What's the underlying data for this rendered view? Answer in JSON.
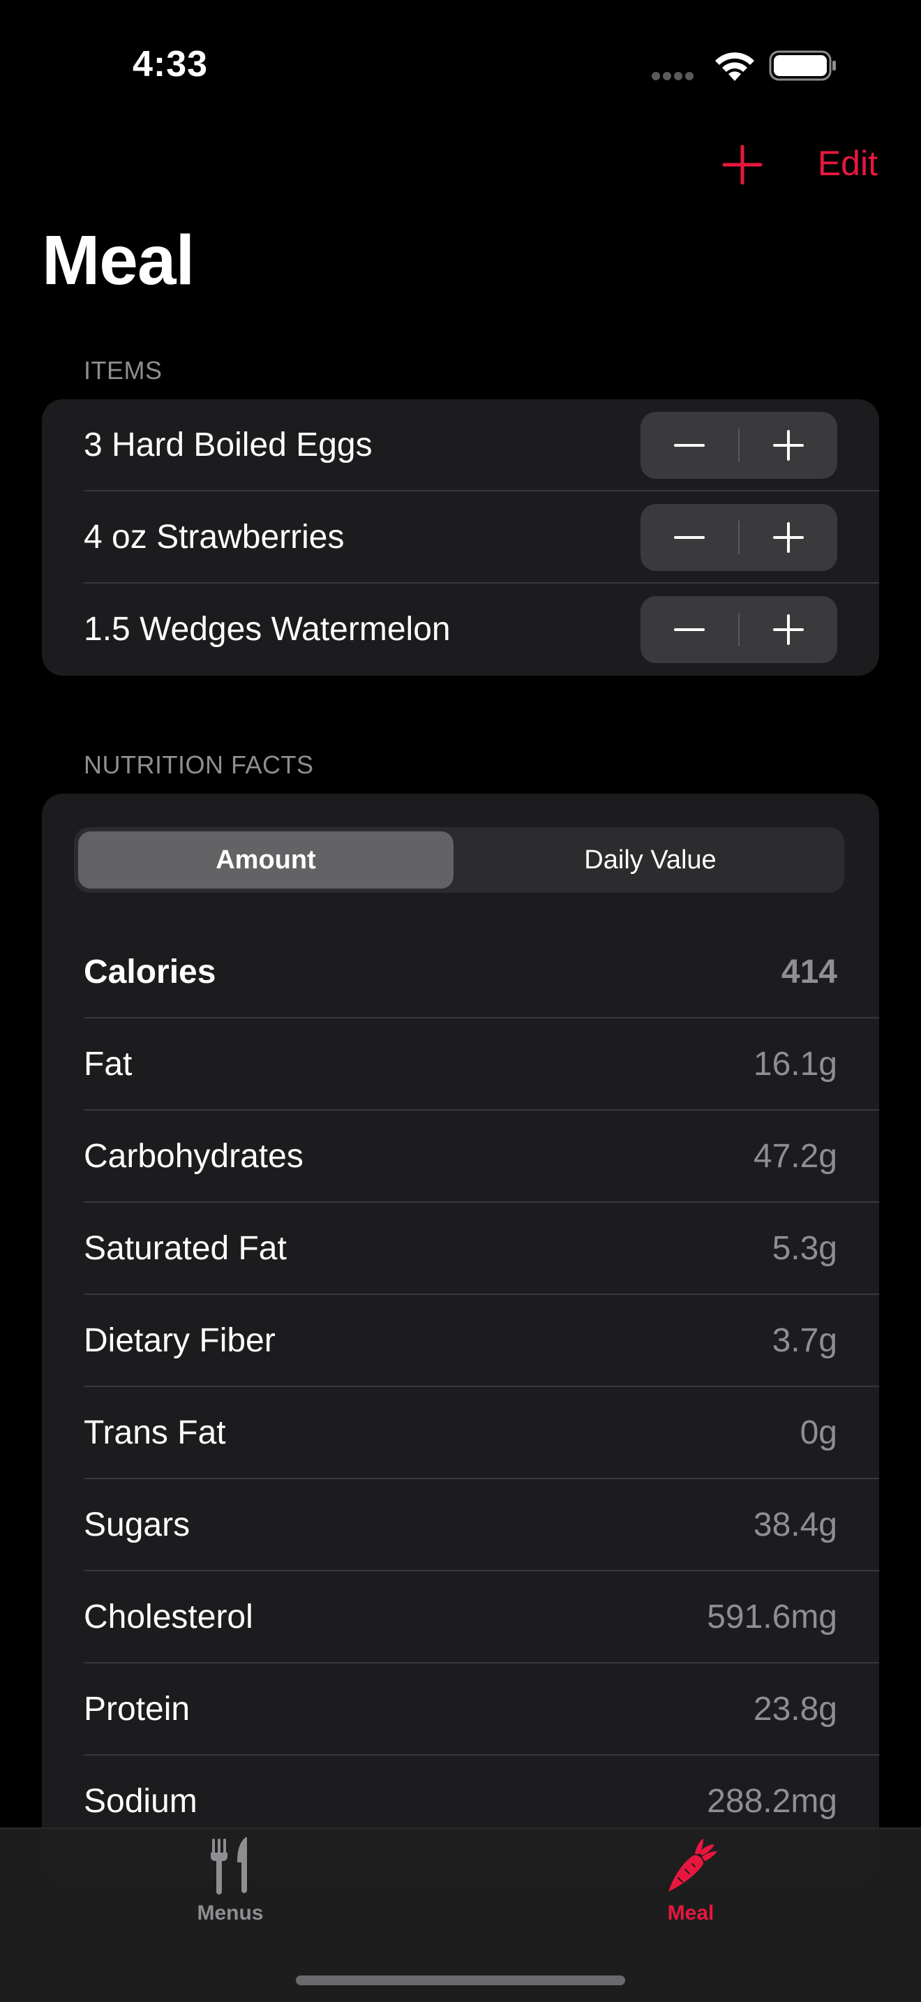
{
  "status_bar": {
    "time": "4:33"
  },
  "nav": {
    "edit_label": "Edit",
    "title": "Meal"
  },
  "items_section": {
    "header": "ITEMS",
    "items": [
      {
        "label": "3 Hard Boiled Eggs"
      },
      {
        "label": "4 oz Strawberries"
      },
      {
        "label": "1.5 Wedges Watermelon"
      }
    ]
  },
  "nutrition_section": {
    "header": "NUTRITION FACTS",
    "segments": {
      "amount": "Amount",
      "daily_value": "Daily Value",
      "selected": "Amount"
    },
    "facts": [
      {
        "name": "Calories",
        "value": "414"
      },
      {
        "name": "Fat",
        "value": "16.1g"
      },
      {
        "name": "Carbohydrates",
        "value": "47.2g"
      },
      {
        "name": "Saturated Fat",
        "value": "5.3g"
      },
      {
        "name": "Dietary Fiber",
        "value": "3.7g"
      },
      {
        "name": "Trans Fat",
        "value": "0g"
      },
      {
        "name": "Sugars",
        "value": "38.4g"
      },
      {
        "name": "Cholesterol",
        "value": "591.6mg"
      },
      {
        "name": "Protein",
        "value": "23.8g"
      },
      {
        "name": "Sodium",
        "value": "288.2mg"
      }
    ]
  },
  "tab_bar": {
    "tabs": [
      {
        "label": "Menus",
        "icon": "fork-knife-icon",
        "selected": false
      },
      {
        "label": "Meal",
        "icon": "carrot-icon",
        "selected": true
      }
    ]
  },
  "colors": {
    "accent": "#e8173f",
    "background": "#000000",
    "card": "#1c1c1e",
    "secondary_text": "#8e8e93"
  }
}
